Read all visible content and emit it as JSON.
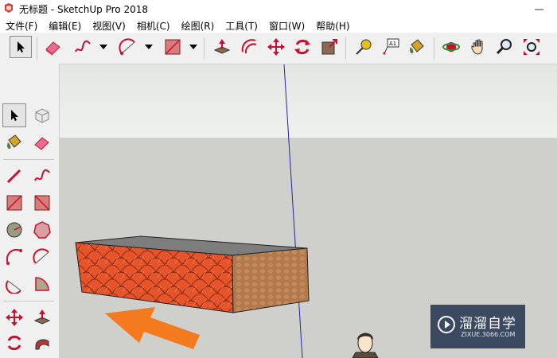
{
  "window": {
    "title": "无标题 - SketchUp Pro 2018",
    "icon": "sketchup-logo-icon",
    "controls": [
      "minimize-icon"
    ]
  },
  "menubar": {
    "items": [
      {
        "label": "文件(F)"
      },
      {
        "label": "编辑(E)"
      },
      {
        "label": "视图(V)"
      },
      {
        "label": "相机(C)"
      },
      {
        "label": "绘图(R)"
      },
      {
        "label": "工具(T)"
      },
      {
        "label": "窗口(W)"
      },
      {
        "label": "帮助(H)"
      }
    ]
  },
  "toolbar": {
    "tools": [
      "select-icon",
      "eraser-icon",
      "freehand-icon",
      "arc-icon",
      "rectangle-icon",
      "push-pull-icon",
      "offset-icon",
      "move-icon",
      "rotate-icon",
      "scale-icon",
      "tape-measure-icon",
      "text-icon",
      "paint-bucket-icon",
      "orbit-icon",
      "pan-icon",
      "zoom-icon",
      "zoom-extents-icon"
    ],
    "text_tool_label": "A1"
  },
  "sidebar": {
    "tools": [
      "select-icon",
      "make-component-icon",
      "paint-bucket-icon",
      "eraser-icon",
      "line-icon",
      "freehand-icon",
      "rectangle-icon",
      "rotated-rectangle-icon",
      "circle-icon",
      "polygon-icon",
      "arc-icon",
      "two-point-arc-icon",
      "three-point-arc-icon",
      "pie-icon",
      "move-icon",
      "push-pull-icon",
      "rotate-icon",
      "follow-me-icon"
    ]
  },
  "viewport": {
    "sky_color": "#e9ecea",
    "ground_color": "#cfcfcb",
    "model": "textured-box",
    "annotation": "orange-arrow",
    "figure": "scale-figure"
  },
  "watermark": {
    "text": "溜溜自学",
    "url": "ZIXUE.3066.COM"
  },
  "colors": {
    "accent_orange": "#f47a1f",
    "brick_red": "#e5542b",
    "stone_brown": "#b57a4c",
    "axis_blue": "#2424a8"
  }
}
